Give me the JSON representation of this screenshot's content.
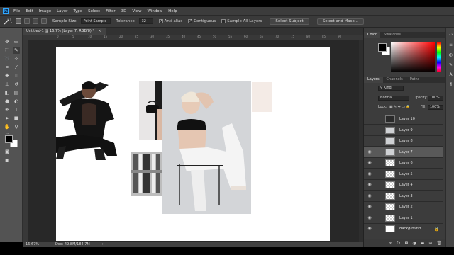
{
  "app": {
    "logo": "Ps",
    "menu": [
      "File",
      "Edit",
      "Image",
      "Layer",
      "Type",
      "Select",
      "Filter",
      "3D",
      "View",
      "Window",
      "Help"
    ]
  },
  "options": {
    "tool_icon": "quick-selection-icon",
    "sample_size_label": "Sample Size:",
    "sample_size_value": "Point Sample",
    "tolerance_label": "Tolerance:",
    "tolerance_value": "32",
    "anti_alias_label": "Anti-alias",
    "anti_alias_checked": true,
    "contiguous_label": "Contiguous",
    "contiguous_checked": true,
    "sample_all_layers_label": "Sample All Layers",
    "sample_all_layers_checked": false,
    "select_subject_label": "Select Subject",
    "select_and_mask_label": "Select and Mask..."
  },
  "document": {
    "tab_title": "Untitled-1 @ 16.7% (Layer 7, RGB/8) *",
    "close_glyph": "×",
    "ruler_ticks": [
      "0",
      "5",
      "10",
      "15",
      "20",
      "25",
      "30",
      "35",
      "40",
      "45",
      "50",
      "55",
      "60",
      "65",
      "70",
      "75",
      "80",
      "85",
      "90"
    ]
  },
  "status": {
    "zoom": "16.67%",
    "doc_info": "Doc: 49.8M/184.7M",
    "arrow": "›"
  },
  "color_panel": {
    "tabs": [
      "Color",
      "Swatches"
    ],
    "foreground": "#000000",
    "background": "#ffffff",
    "hue_color": "#ff0000"
  },
  "layers_panel": {
    "tabs": [
      "Layers",
      "Channels",
      "Paths"
    ],
    "filter_value": "Kind",
    "blend_mode": "Normal",
    "opacity_label": "Opacity:",
    "opacity_value": "100%",
    "lock_label": "Lock:",
    "fill_label": "Fill:",
    "fill_value": "100%",
    "layers": [
      {
        "name": "Layer 10",
        "visible": false,
        "selected": false,
        "thumb": "photo-bag"
      },
      {
        "name": "Layer 9",
        "visible": false,
        "selected": false,
        "thumb": "photo-model"
      },
      {
        "name": "Layer 8",
        "visible": false,
        "selected": false,
        "thumb": "photo-model"
      },
      {
        "name": "Layer 7",
        "visible": true,
        "selected": true,
        "thumb": "photo-model"
      },
      {
        "name": "Layer 6",
        "visible": true,
        "selected": false,
        "thumb": "transparent"
      },
      {
        "name": "Layer 5",
        "visible": true,
        "selected": false,
        "thumb": "transparent"
      },
      {
        "name": "Layer 4",
        "visible": true,
        "selected": false,
        "thumb": "transparent"
      },
      {
        "name": "Layer 3",
        "visible": true,
        "selected": false,
        "thumb": "transparent"
      },
      {
        "name": "Layer 2",
        "visible": true,
        "selected": false,
        "thumb": "transparent"
      },
      {
        "name": "Layer 1",
        "visible": true,
        "selected": false,
        "thumb": "transparent"
      },
      {
        "name": "Background",
        "visible": true,
        "selected": false,
        "thumb": "white",
        "locked": true
      }
    ],
    "footer_icons": [
      "link-icon",
      "fx-icon",
      "mask-icon",
      "adjustment-icon",
      "group-icon",
      "new-layer-icon",
      "trash-icon"
    ]
  },
  "canvas": {
    "background": "#ffffff",
    "images": [
      "model-black-outfit",
      "bag-closeup",
      "building-facade",
      "model-white-outfit",
      "blush-square"
    ]
  }
}
